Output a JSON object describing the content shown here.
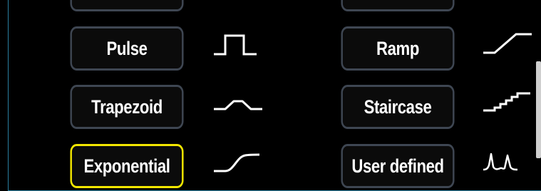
{
  "waveforms": {
    "pulse": {
      "label": "Pulse",
      "icon": "pulse-waveform-icon"
    },
    "ramp": {
      "label": "Ramp",
      "icon": "ramp-waveform-icon"
    },
    "trapezoid": {
      "label": "Trapezoid",
      "icon": "trapezoid-waveform-icon"
    },
    "staircase": {
      "label": "Staircase",
      "icon": "staircase-waveform-icon"
    },
    "exponential": {
      "label": "Exponential",
      "icon": "exponential-waveform-icon",
      "selected": true
    },
    "user_defined": {
      "label": "User defined",
      "icon": "user-defined-waveform-icon"
    }
  },
  "colors": {
    "background": "#000000",
    "button_border": "#3e4652",
    "selected_border": "#f2e600",
    "text": "#ffffff",
    "panel_edge": "#2a7fa0"
  }
}
